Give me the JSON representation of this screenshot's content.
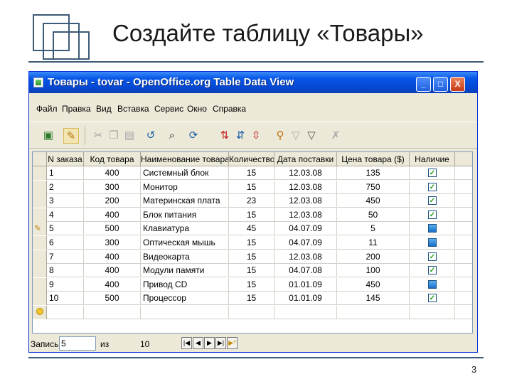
{
  "slide": {
    "title": "Создайте таблицу «Товары»",
    "page_number": "3"
  },
  "window": {
    "title": "Товары - tovar - OpenOffice.org Table Data View",
    "buttons": {
      "minimize": "_",
      "maximize": "□",
      "close": "X"
    }
  },
  "menu": [
    "Файл",
    "Правка",
    "Вид",
    "Вставка",
    "Сервис",
    "Окно",
    "Справка"
  ],
  "toolbar": {
    "icons": [
      "save-icon",
      "edit-icon",
      "cut-icon",
      "copy-icon",
      "paste-icon",
      "undo-icon",
      "find-icon",
      "refresh-icon",
      "sort-ascending-icon",
      "sort-descending-icon",
      "sort-icon",
      "autofilter-icon",
      "standard-filter-icon",
      "filter-icon",
      "remove-filter-icon"
    ]
  },
  "table": {
    "columns": [
      "N заказа",
      "Код товара",
      "Наименование товара",
      "Количество",
      "Дата поставки",
      "Цена товара ($)",
      "Наличие"
    ],
    "rows": [
      {
        "n": "1",
        "code": "400",
        "name": "Системный блок",
        "qty": "15",
        "date": "12.03.08",
        "price": "135",
        "avail": true,
        "blue": false
      },
      {
        "n": "2",
        "code": "300",
        "name": "Монитор",
        "qty": "15",
        "date": "12.03.08",
        "price": "750",
        "avail": true,
        "blue": false
      },
      {
        "n": "3",
        "code": "200",
        "name": "Материнская плата",
        "qty": "23",
        "date": "12.03.08",
        "price": "450",
        "avail": true,
        "blue": false
      },
      {
        "n": "4",
        "code": "400",
        "name": "Блок питания",
        "qty": "15",
        "date": "12.03.08",
        "price": "50",
        "avail": true,
        "blue": false
      },
      {
        "n": "5",
        "code": "500",
        "name": "Клавиатура",
        "qty": "45",
        "date": "04.07.09",
        "price": "5",
        "avail": false,
        "blue": true
      },
      {
        "n": "6",
        "code": "300",
        "name": "Оптическая мышь",
        "qty": "15",
        "date": "04.07.09",
        "price": "11",
        "avail": false,
        "blue": true
      },
      {
        "n": "7",
        "code": "400",
        "name": "Видеокарта",
        "qty": "15",
        "date": "12.03.08",
        "price": "200",
        "avail": true,
        "blue": false
      },
      {
        "n": "8",
        "code": "400",
        "name": "Модули памяти",
        "qty": "15",
        "date": "04.07.08",
        "price": "100",
        "avail": true,
        "blue": false
      },
      {
        "n": "9",
        "code": "400",
        "name": "Привод CD",
        "qty": "15",
        "date": "01.01.09",
        "price": "450",
        "avail": false,
        "blue": true
      },
      {
        "n": "10",
        "code": "500",
        "name": "Процессор",
        "qty": "15",
        "date": "01.01.09",
        "price": "145",
        "avail": true,
        "blue": false
      }
    ],
    "current_row_index": 4
  },
  "statusbar": {
    "record_label": "Запись",
    "record_value": "5",
    "of_label": "из",
    "total": "10",
    "nav": [
      "|◀",
      "◀",
      "▶",
      "▶|",
      "▶*"
    ]
  }
}
